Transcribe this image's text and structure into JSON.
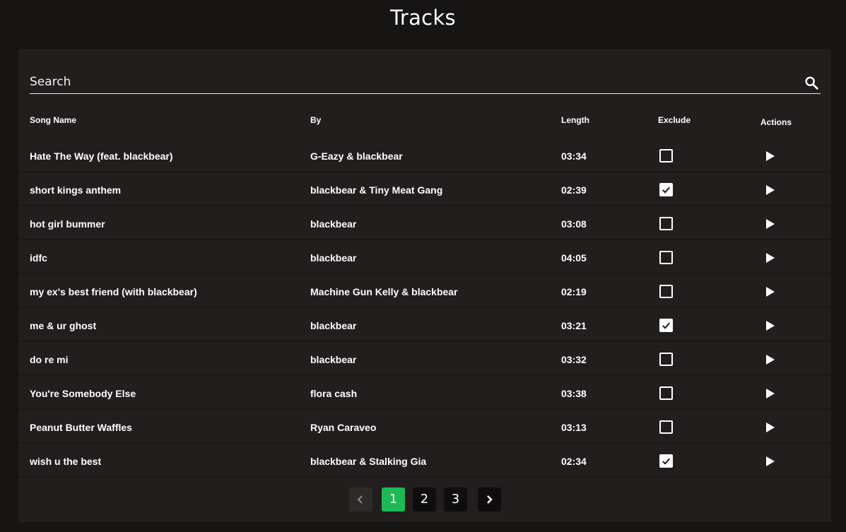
{
  "page": {
    "title": "Tracks"
  },
  "search": {
    "placeholder": "Search"
  },
  "table": {
    "headers": {
      "name": "Song Name",
      "by": "By",
      "length": "Length",
      "exclude": "Exclude",
      "actions": "Actions"
    },
    "rows": [
      {
        "name": "Hate The Way (feat. blackbear)",
        "by": "G-Eazy & blackbear",
        "length": "03:34",
        "excluded": false
      },
      {
        "name": "short kings anthem",
        "by": "blackbear & Tiny Meat Gang",
        "length": "02:39",
        "excluded": true
      },
      {
        "name": "hot girl bummer",
        "by": "blackbear",
        "length": "03:08",
        "excluded": false
      },
      {
        "name": "idfc",
        "by": "blackbear",
        "length": "04:05",
        "excluded": false
      },
      {
        "name": "my ex's best friend (with blackbear)",
        "by": "Machine Gun Kelly & blackbear",
        "length": "02:19",
        "excluded": false
      },
      {
        "name": "me & ur ghost",
        "by": "blackbear",
        "length": "03:21",
        "excluded": true
      },
      {
        "name": "do re mi",
        "by": "blackbear",
        "length": "03:32",
        "excluded": false
      },
      {
        "name": "You're Somebody Else",
        "by": "flora cash",
        "length": "03:38",
        "excluded": false
      },
      {
        "name": "Peanut Butter Waffles",
        "by": "Ryan Caraveo",
        "length": "03:13",
        "excluded": false
      },
      {
        "name": "wish u the best",
        "by": "blackbear & Stalking Gia",
        "length": "02:34",
        "excluded": true
      }
    ]
  },
  "pagination": {
    "pages": [
      "1",
      "2",
      "3"
    ],
    "current": "1"
  },
  "colors": {
    "background": "#171414",
    "panel": "#221e1e",
    "accent": "#1db954"
  },
  "icons": {
    "search": "search-icon",
    "play": "play-icon",
    "check": "check-icon",
    "prev": "chevron-left-icon",
    "next": "chevron-right-icon"
  }
}
